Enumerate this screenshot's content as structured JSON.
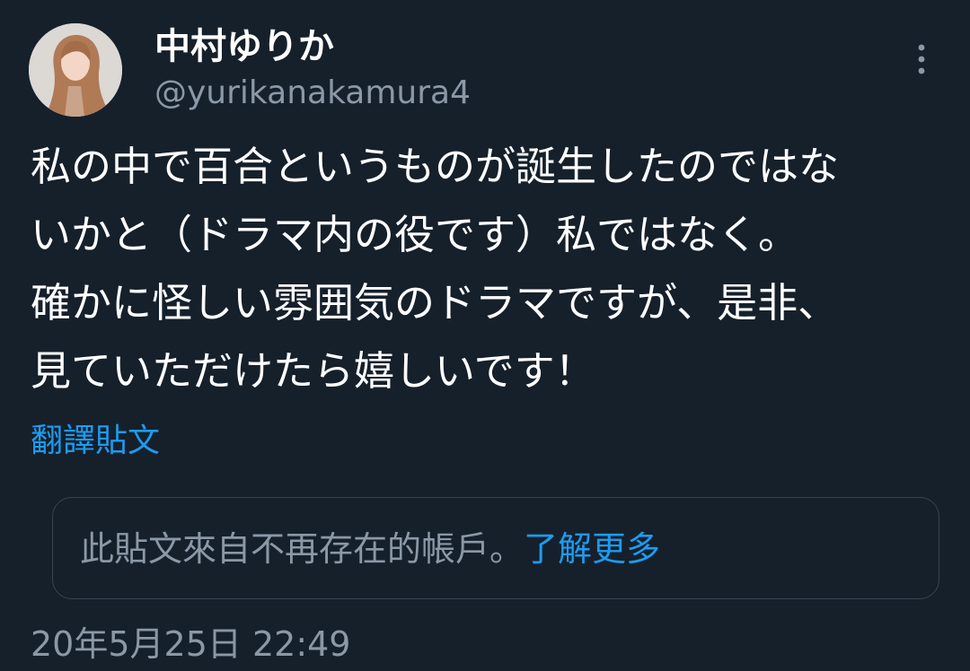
{
  "author": {
    "display_name": "中村ゆりか",
    "handle": "@yurikanakamura4",
    "avatar_icon": "profile-photo"
  },
  "menu": {
    "icon": "vertical-ellipsis-icon"
  },
  "tweet": {
    "lines": [
      "私の中で百合というものが誕生したのではな",
      "いかと（ドラマ内の役です）私ではなく。",
      "確かに怪しい雰囲気のドラマですが、是非、",
      "見ていただけたら嬉しいです！"
    ],
    "translate_label": "翻譯貼文"
  },
  "notice": {
    "text": "此貼文來自不再存在的帳戶。",
    "link_label": "了解更多"
  },
  "timestamp": "20年5月25日 22:49",
  "colors": {
    "background": "#15202b",
    "primary_text": "#ffffff",
    "secondary_text": "#8b98a5",
    "link": "#1d9bf0",
    "border": "#38444d"
  }
}
